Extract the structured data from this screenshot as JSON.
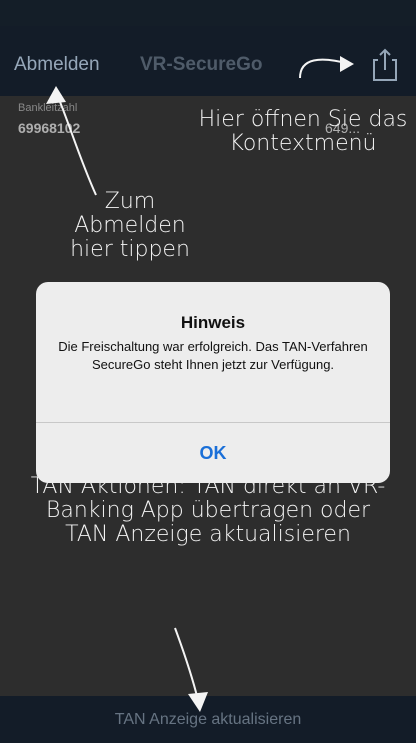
{
  "status_bar": {
    "carrier": "",
    "time": "",
    "battery": ""
  },
  "nav": {
    "logout_label": "Abmelden",
    "title": "VR-SecureGo"
  },
  "fields": {
    "label_left": "Bankleitzahl",
    "value_left": "69968102",
    "value_right": "649..."
  },
  "annotations": {
    "context_menu": "Hier öffnen Sie das Kontextmenü",
    "logout": "Zum Abmelden hier tippen",
    "tan_actions": "TAN Aktionen: TAN direkt an VR-Banking App übertragen oder TAN Anzeige aktualisieren"
  },
  "alert": {
    "title": "Hinweis",
    "message": "Die Freischaltung war erfolgreich. Das TAN-Verfahren SecureGo steht Ihnen jetzt zur Verfügung.",
    "ok_label": "OK"
  },
  "bottom": {
    "button_label": "TAN Anzeige aktualisieren"
  },
  "colors": {
    "nav_bg": "#1b2838",
    "alert_bg": "#ededed",
    "ok_blue": "#1a6fd8"
  }
}
